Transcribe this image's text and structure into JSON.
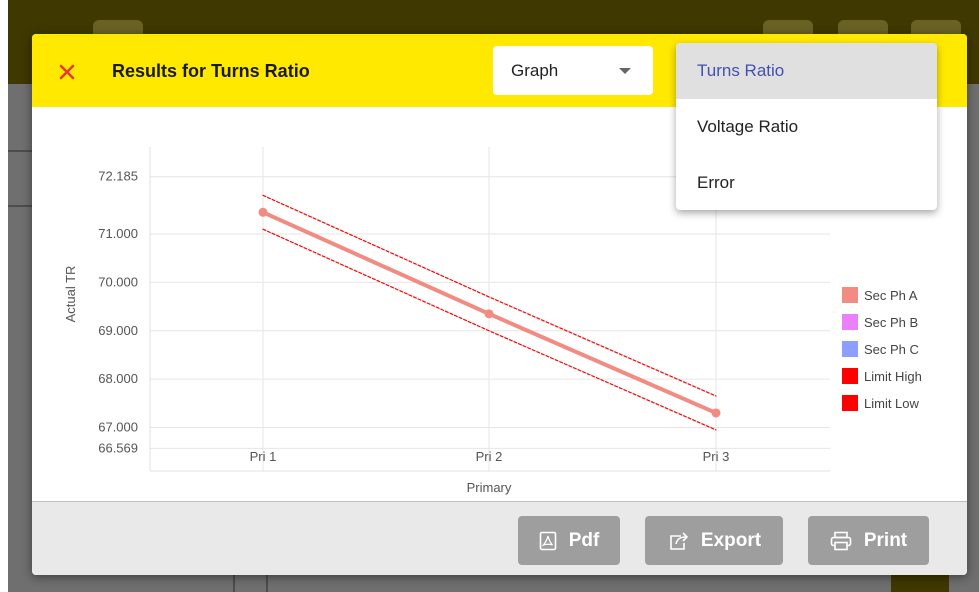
{
  "dialog": {
    "title": "Results for Turns Ratio",
    "view_select": {
      "value": "Graph"
    },
    "close_color": "#e53935",
    "header_color": "#ffe900"
  },
  "menu": {
    "items": [
      {
        "label": "Turns Ratio",
        "selected": true
      },
      {
        "label": "Voltage Ratio",
        "selected": false
      },
      {
        "label": "Error",
        "selected": false
      }
    ],
    "selected_color": "#3f51b5"
  },
  "footer": {
    "pdf_label": "Pdf",
    "export_label": "Export",
    "print_label": "Print"
  },
  "chart_data": {
    "type": "line",
    "xlabel": "Primary",
    "ylabel": "Actual TR",
    "categories": [
      "Pri 1",
      "Pri 2",
      "Pri 3"
    ],
    "y_ticks": [
      "72.185",
      "71.000",
      "70.000",
      "69.000",
      "68.000",
      "67.000",
      "66.569"
    ],
    "ylim": [
      66.1,
      72.8
    ],
    "grid": true,
    "legend_position": "right",
    "series": [
      {
        "name": "Sec Ph A",
        "color": "#f28b82",
        "values": [
          71.45,
          69.35,
          67.3
        ]
      },
      {
        "name": "Sec Ph B",
        "color": "#ea80fc",
        "values": []
      },
      {
        "name": "Sec Ph C",
        "color": "#8c9eff",
        "values": []
      },
      {
        "name": "Limit High",
        "color": "#ff0000",
        "values": [
          71.8,
          69.7,
          67.65
        ]
      },
      {
        "name": "Limit Low",
        "color": "#ff0000",
        "values": [
          71.1,
          69.0,
          66.95
        ]
      }
    ]
  }
}
